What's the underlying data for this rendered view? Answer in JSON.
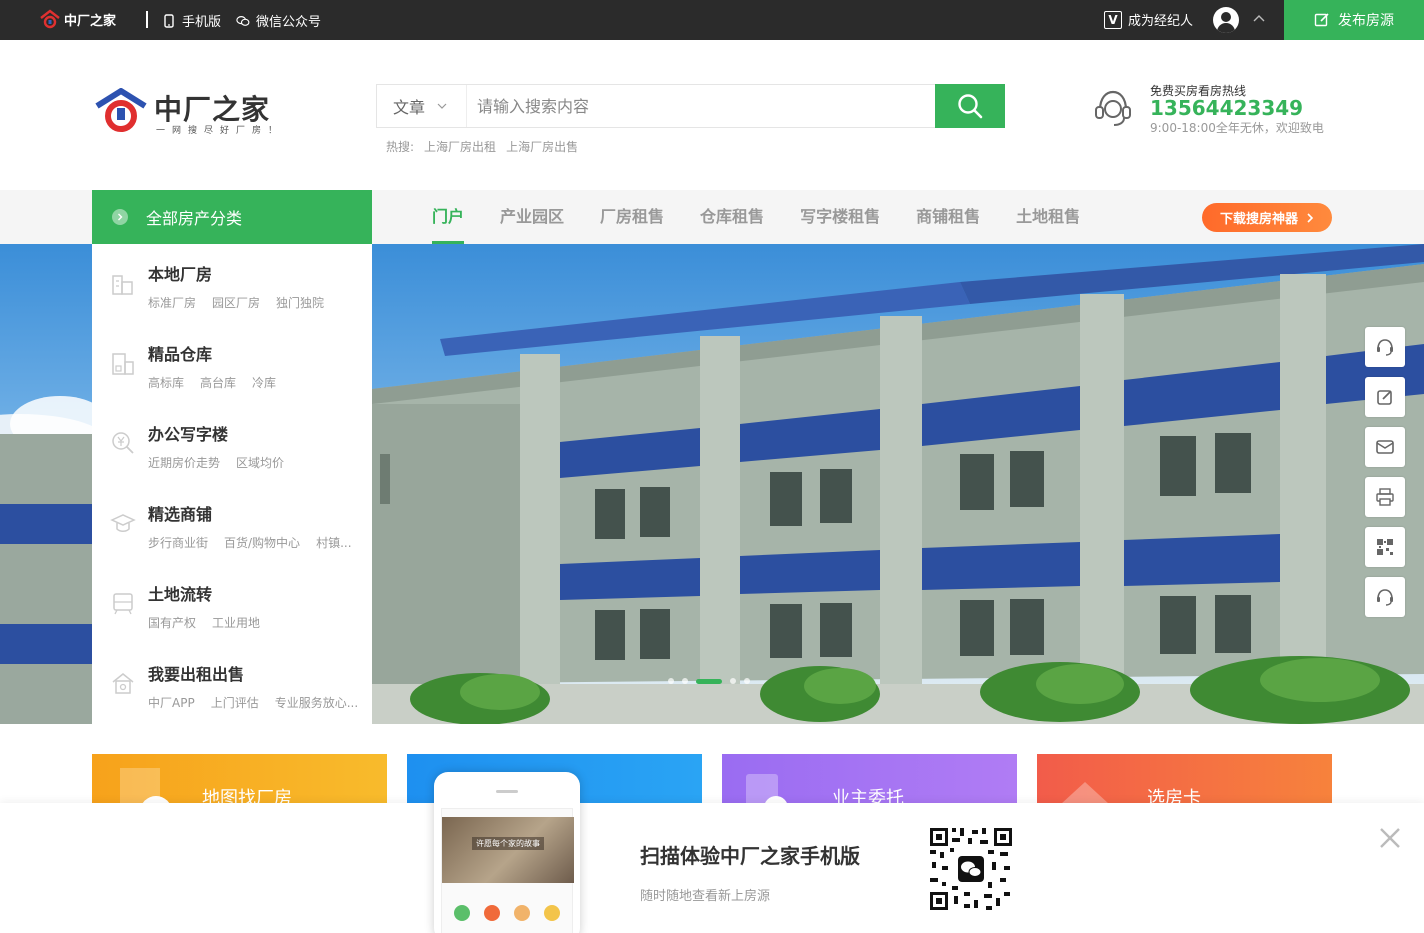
{
  "topbar": {
    "logo_text": "中厂之家",
    "mobile_label": "手机版",
    "wechat_label": "微信公众号",
    "agent_label": "成为经纪人",
    "agent_mark": "V",
    "publish_label": "发布房源"
  },
  "header": {
    "logo_title": "中厂之家",
    "logo_slogan": "一网搜尽好厂房！",
    "search": {
      "scope": "文章",
      "placeholder": "请输入搜索内容",
      "value": ""
    },
    "hot": {
      "label": "热搜:",
      "items": [
        "上海厂房出租",
        "上海厂房出售"
      ]
    },
    "hotline": {
      "title": "免费买房看房热线",
      "phone": "13564423349",
      "hours": "9:00-18:00全年无休，欢迎致电"
    }
  },
  "nav": {
    "category_label": "全部房产分类",
    "items": [
      "门户",
      "产业园区",
      "厂房租售",
      "仓库租售",
      "写字楼租售",
      "商铺租售",
      "土地租售"
    ],
    "active_index": 0,
    "download_label": "下载搜房神器"
  },
  "categories": [
    {
      "title": "本地厂房",
      "icon": "factory-icon",
      "subs": [
        "标准厂房",
        "园区厂房",
        "独门独院"
      ]
    },
    {
      "title": "精品仓库",
      "icon": "warehouse-icon",
      "subs": [
        "高标库",
        "高台库",
        "冷库"
      ]
    },
    {
      "title": "办公写字楼",
      "icon": "price-search-icon",
      "subs": [
        "近期房价走势",
        "区域均价"
      ]
    },
    {
      "title": "精选商铺",
      "icon": "graduation-cap-icon",
      "subs": [
        "步行商业街",
        "百货/购物中心",
        "村镇..."
      ]
    },
    {
      "title": "土地流转",
      "icon": "land-icon",
      "subs": [
        "国有产权",
        "工业用地"
      ]
    },
    {
      "title": "我要出租出售",
      "icon": "house-icon",
      "subs": [
        "中厂APP",
        "上门评估",
        "专业服务放心..."
      ]
    }
  ],
  "banner": {
    "slide_count": 5,
    "active_slide": 2
  },
  "sidetools": [
    "headset-icon",
    "edit-icon",
    "mail-icon",
    "app-icon",
    "qrcode-icon",
    "headset-icon"
  ],
  "cards": [
    {
      "label": "地图找厂房",
      "color_start": "#f7a21b",
      "color_end": "#f8bb2c"
    },
    {
      "label": "",
      "color_start": "#1e90f0",
      "color_end": "#2aa4f4"
    },
    {
      "label": "业主委托",
      "color_start": "#9a6cf2",
      "color_end": "#b07cf4"
    },
    {
      "label": "选房卡",
      "color_start": "#f25c4a",
      "color_end": "#f7823c"
    }
  ],
  "popup": {
    "title": "扫描体验中厂之家手机版",
    "subtitle": "随时随地查看新上房源",
    "phone_banner_text": "许愿每个家的故事"
  },
  "colors": {
    "brand_green": "#36b35a",
    "topbar_bg": "#2b2b2b",
    "download_orange": "#ff7a33"
  }
}
